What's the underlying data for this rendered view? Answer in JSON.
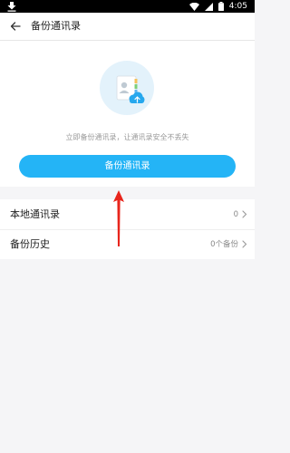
{
  "status_bar": {
    "time": "4:05"
  },
  "app_bar": {
    "title": "备份通讯录"
  },
  "hero": {
    "hint": "立即备份通讯录，让通讯录安全不丢失",
    "button_label": "备份通讯录"
  },
  "list": {
    "local": {
      "label": "本地通讯录",
      "value": "0"
    },
    "history": {
      "label": "备份历史",
      "value": "0个备份"
    }
  },
  "colors": {
    "accent": "#24b4f6",
    "annotation_arrow": "#e8251c"
  }
}
